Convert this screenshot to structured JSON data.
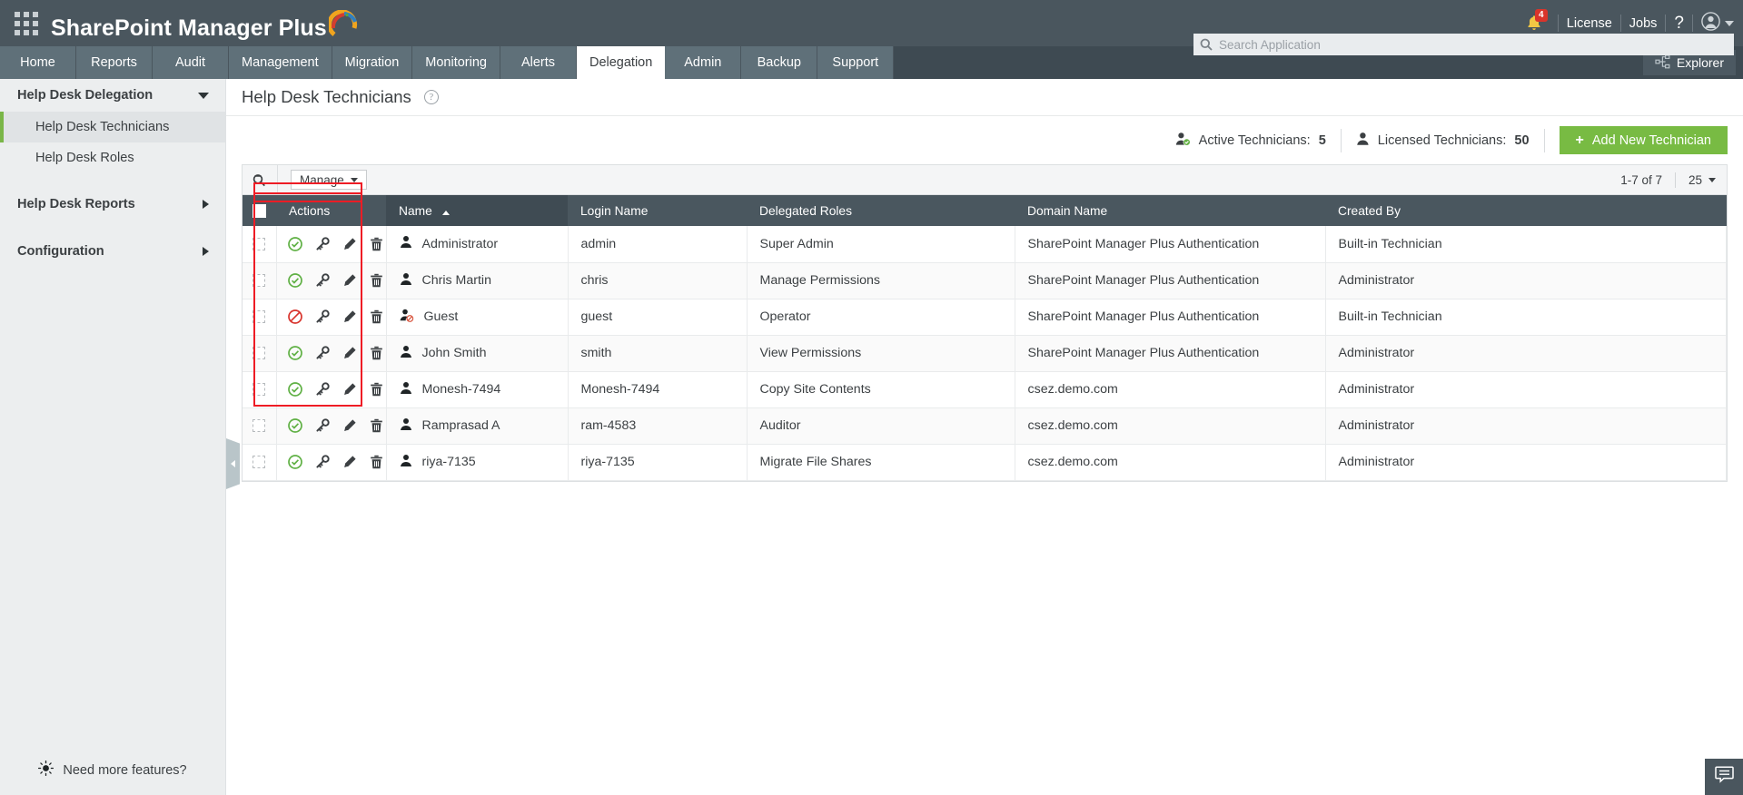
{
  "app": {
    "brand": "SharePoint Manager Plus",
    "waffle_icon": "grid-apps-icon"
  },
  "topbar": {
    "notifications_icon": "bell-icon",
    "notifications_count": "4",
    "license_label": "License",
    "jobs_label": "Jobs",
    "help_label": "?",
    "account_icon": "user-avatar-icon"
  },
  "search": {
    "icon": "search-icon",
    "placeholder": "Search Application",
    "value": ""
  },
  "nav": {
    "tabs": [
      {
        "label": "Home",
        "active": false
      },
      {
        "label": "Reports",
        "active": false
      },
      {
        "label": "Audit",
        "active": false
      },
      {
        "label": "Management",
        "active": false
      },
      {
        "label": "Migration",
        "active": false
      },
      {
        "label": "Monitoring",
        "active": false
      },
      {
        "label": "Alerts",
        "active": false
      },
      {
        "label": "Delegation",
        "active": true
      },
      {
        "label": "Admin",
        "active": false
      },
      {
        "label": "Backup",
        "active": false
      },
      {
        "label": "Support",
        "active": false
      }
    ],
    "explorer_label": "Explorer",
    "explorer_icon": "sitemap-icon"
  },
  "sidebar": {
    "groups": [
      {
        "label": "Help Desk Delegation",
        "state": "expanded",
        "icon": "chevron-down-icon"
      },
      {
        "label": "Help Desk Reports",
        "state": "collapsed",
        "icon": "chevron-right-icon"
      },
      {
        "label": "Configuration",
        "state": "collapsed",
        "icon": "chevron-right-icon"
      }
    ],
    "items": [
      {
        "label": "Help Desk Technicians",
        "active": true
      },
      {
        "label": "Help Desk Roles",
        "active": false
      }
    ],
    "footer": {
      "label": "Need more features?",
      "icon": "lightbulb-icon"
    },
    "collapse_handle_icon": "chevron-right-icon"
  },
  "page": {
    "title": "Help Desk Technicians",
    "help_icon": "question-mark-icon"
  },
  "counts": {
    "active_label": "Active Technicians:",
    "active_value": "5",
    "active_icon": "user-check-icon",
    "licensed_label": "Licensed Technicians:",
    "licensed_value": "50",
    "licensed_icon": "user-icon",
    "add_button_label": "Add New Technician",
    "add_button_icon": "plus-icon",
    "add_button_color": "#78bb43"
  },
  "toolbar": {
    "search_icon": "search-toggle-icon",
    "manage_label": "Manage",
    "manage_caret_icon": "chevron-down-icon",
    "pager_text": "1-7 of 7",
    "page_size": "25",
    "page_size_caret_icon": "chevron-down-icon"
  },
  "table": {
    "columns": [
      "Actions",
      "Name",
      "Login Name",
      "Delegated Roles",
      "Domain Name",
      "Created By"
    ],
    "sorted_column": "Name",
    "sort_direction": "ascending",
    "select_all_checkbox": false,
    "row_action_icons": [
      "enabled-status-icon",
      "key-icon",
      "pencil-icon",
      "trash-icon"
    ],
    "rows": [
      {
        "selected": false,
        "status": "enabled",
        "status_icon": "check-circle-icon",
        "user_icon": "user-icon",
        "name": "Administrator",
        "login": "admin",
        "role": "Super Admin",
        "domain": "SharePoint Manager Plus Authentication",
        "created_by": "Built-in Technician"
      },
      {
        "selected": false,
        "status": "enabled",
        "status_icon": "check-circle-icon",
        "user_icon": "user-icon",
        "name": "Chris Martin",
        "login": "chris",
        "role": "Manage Permissions",
        "domain": "SharePoint Manager Plus Authentication",
        "created_by": "Administrator"
      },
      {
        "selected": false,
        "status": "disabled",
        "status_icon": "block-circle-icon",
        "user_icon": "user-disabled-icon",
        "name": "Guest",
        "login": "guest",
        "role": "Operator",
        "domain": "SharePoint Manager Plus Authentication",
        "created_by": "Built-in Technician"
      },
      {
        "selected": false,
        "status": "enabled",
        "status_icon": "check-circle-icon",
        "user_icon": "user-icon",
        "name": "John Smith",
        "login": "smith",
        "role": "View Permissions",
        "domain": "SharePoint Manager Plus Authentication",
        "created_by": "Administrator"
      },
      {
        "selected": false,
        "status": "enabled",
        "status_icon": "check-circle-icon",
        "user_icon": "user-icon",
        "name": "Monesh-7494",
        "login": "Monesh-7494",
        "role": "Copy Site Contents",
        "domain": "csez.demo.com",
        "created_by": "Administrator"
      },
      {
        "selected": false,
        "status": "enabled",
        "status_icon": "check-circle-icon",
        "user_icon": "user-icon",
        "name": "Ramprasad A",
        "login": "ram-4583",
        "role": "Auditor",
        "domain": "csez.demo.com",
        "created_by": "Administrator"
      },
      {
        "selected": false,
        "status": "enabled",
        "status_icon": "check-circle-icon",
        "user_icon": "user-icon",
        "name": "riya-7135",
        "login": "riya-7135",
        "role": "Migrate File Shares",
        "domain": "csez.demo.com",
        "created_by": "Administrator"
      }
    ]
  },
  "annotations": {
    "highlight_color": "#ee1c25",
    "highlight_targets": [
      "manage-button",
      "actions-column"
    ]
  },
  "chat": {
    "icon": "chat-bubble-icon"
  }
}
